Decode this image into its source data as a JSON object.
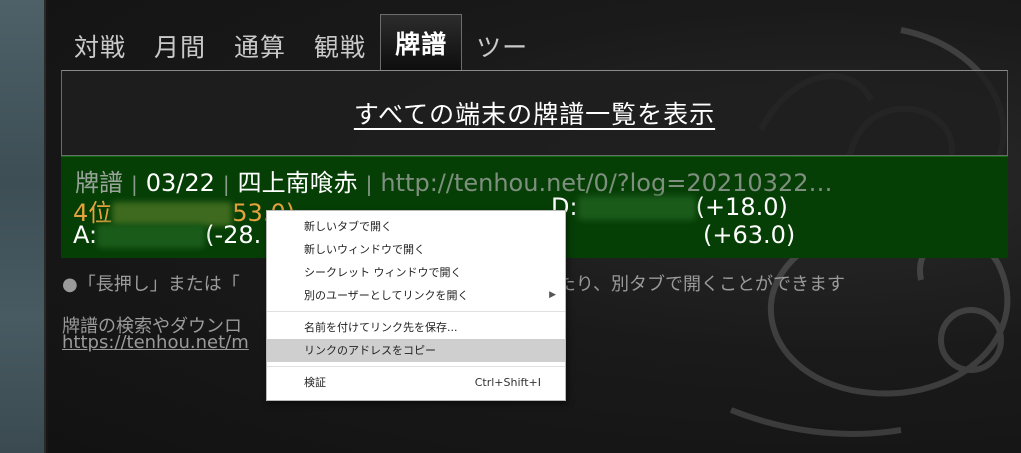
{
  "tabs": [
    {
      "label": "対戦",
      "active": false
    },
    {
      "label": "月間",
      "active": false
    },
    {
      "label": "通算",
      "active": false
    },
    {
      "label": "観戦",
      "active": false
    },
    {
      "label": "牌譜",
      "active": true
    },
    {
      "label": "ツー",
      "active": false
    }
  ],
  "panel": {
    "show_all_link": "すべての端末の牌譜一覧を表示"
  },
  "log": {
    "label": "牌譜",
    "date": "03/22",
    "rule": "四上南喰赤",
    "url": "http://tenhou.net/0/?log=20210322…",
    "line2_prefix": "4位",
    "line2_score": "53.0)",
    "line2_d": "D:",
    "line2_d_score": "(+18.0)",
    "line3_a": "A:",
    "line3_a_score": "(-28.",
    "line3_b_score": "(+63.0)"
  },
  "notes": {
    "note1_a": "●「長押し」または「",
    "note1_b": "ったり、別タブで開くことができます",
    "note2": "牌譜の検索やダウンロ",
    "note3": "https://tenhou.net/m"
  },
  "context_menu": {
    "items": [
      {
        "label": "新しいタブで開く"
      },
      {
        "label": "新しいウィンドウで開く"
      },
      {
        "label": "シークレット ウィンドウで開く"
      },
      {
        "label": "別のユーザーとしてリンクを開く",
        "submenu": true
      },
      {
        "label": "名前を付けてリンク先を保存..."
      },
      {
        "label": "リンクのアドレスをコピー",
        "highlighted": true
      },
      {
        "label": "検証",
        "shortcut": "Ctrl+Shift+I"
      }
    ],
    "submenu_icon": "chevron-right-icon"
  },
  "colors": {
    "log_bg": "#063f06",
    "highlight_orange": "#e6a23c",
    "menu_hover": "#cfcfcf"
  }
}
